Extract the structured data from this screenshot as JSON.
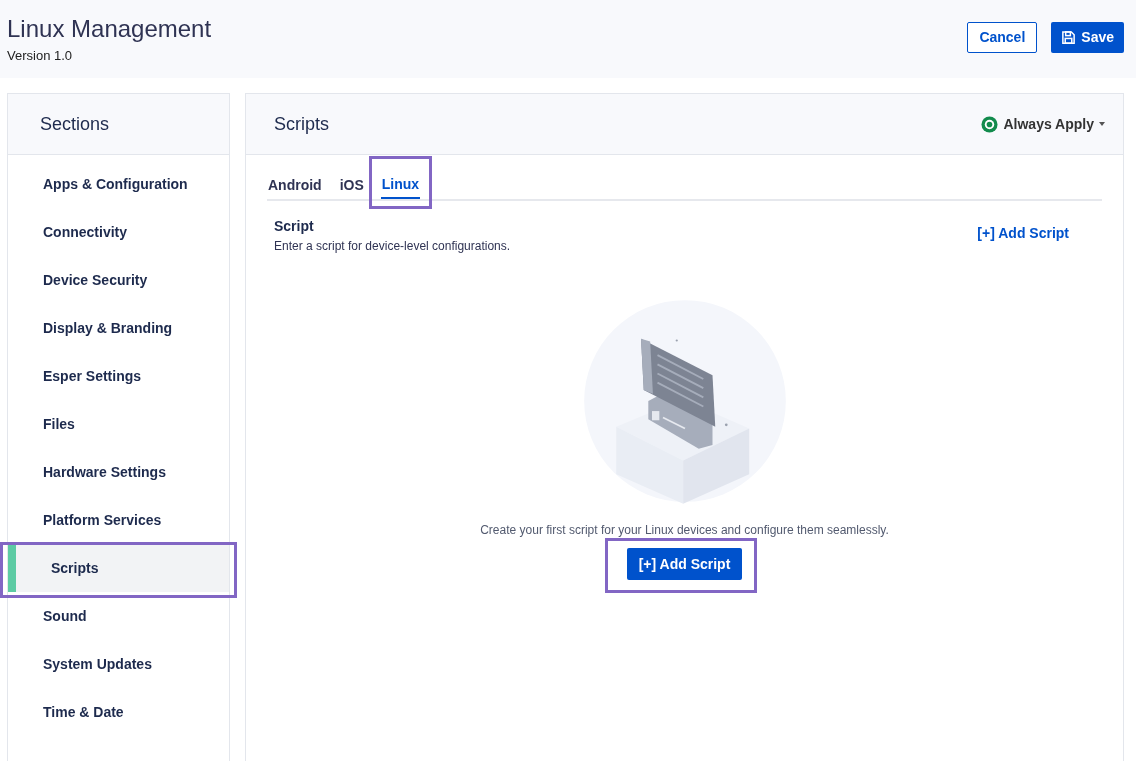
{
  "header": {
    "title": "Linux Management",
    "version": "Version 1.0",
    "buttons": [
      {
        "kind": "outline",
        "label": "Cancel"
      },
      {
        "kind": "primary",
        "label": "Save"
      }
    ]
  },
  "sidebar": {
    "title": "Sections",
    "items": [
      {
        "label": "Apps & Configuration",
        "selected": false,
        "highlighted": false
      },
      {
        "label": "Connectivity",
        "selected": false,
        "highlighted": false
      },
      {
        "label": "Device Security",
        "selected": false,
        "highlighted": false
      },
      {
        "label": "Display & Branding",
        "selected": false,
        "highlighted": false
      },
      {
        "label": "Esper Settings",
        "selected": false,
        "highlighted": false
      },
      {
        "label": "Files",
        "selected": false,
        "highlighted": false
      },
      {
        "label": "Hardware Settings",
        "selected": false,
        "highlighted": false
      },
      {
        "label": "Platform Services",
        "selected": false,
        "highlighted": false
      },
      {
        "label": "Scripts",
        "selected": true,
        "highlighted": true
      },
      {
        "label": "Sound",
        "selected": false,
        "highlighted": false
      },
      {
        "label": "System Updates",
        "selected": false,
        "highlighted": false
      },
      {
        "label": "Time & Date",
        "selected": false,
        "highlighted": false
      }
    ]
  },
  "panel": {
    "title": "Scripts",
    "apply": "Always Apply",
    "tabs": [
      {
        "label": "Android",
        "selected": false,
        "highlighted": false
      },
      {
        "label": "iOS",
        "selected": false,
        "highlighted": false
      },
      {
        "label": "Linux",
        "selected": true,
        "highlighted": true
      }
    ],
    "section_title": "Script",
    "section_desc": "Enter a script for device-level configurations.",
    "add_link": "[+] Add Script",
    "empty": {
      "kind": "picture",
      "message": "Create your first script for your Linux devices and configure them seamlessly.",
      "button": "[+] Add Script",
      "highlighted": true
    }
  }
}
